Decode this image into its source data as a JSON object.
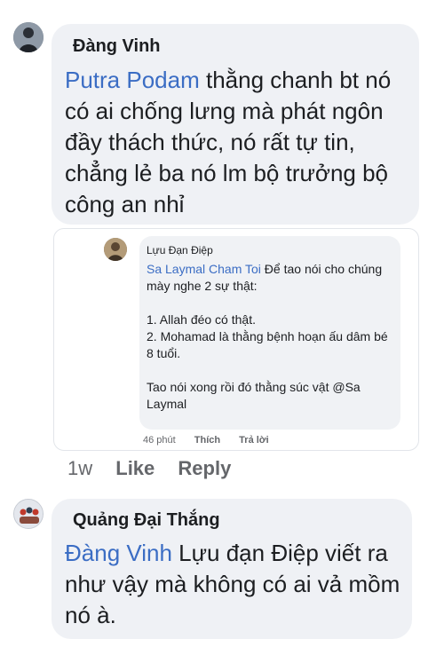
{
  "comment1": {
    "author": "Đàng Vinh",
    "mention": "Putra Podam",
    "text": "  thằng chanh bt nó có ai chống lưng mà phát ngôn đầy thách thức, nó rất tự tin, chẳng lẻ ba nó lm bộ trưởng bộ công an nhỉ",
    "time": "1w",
    "like_label": "Like",
    "reply_label": "Reply"
  },
  "embedded": {
    "author": "Lựu Đạn Điệp",
    "mention": "Sa Laymal Cham Toi",
    "intro": " Để tao nói cho chúng mày nghe 2 sự thật:",
    "line1": "1. Allah đéo có thật.",
    "line2": "2. Mohamad là thằng bệnh hoạn ấu dâm bé 8 tuổi.",
    "line3": "Tao nói xong rồi đó thằng súc vật @Sa Laymal",
    "time": "46 phút",
    "like_label": "Thích",
    "reply_label": "Trả lời"
  },
  "comment2": {
    "author": "Quảng Đại Thắng",
    "mention": "Đàng Vinh",
    "text": " Lựu đạn Điệp  viết ra như vậy mà không có ai vả mồm nó à."
  }
}
